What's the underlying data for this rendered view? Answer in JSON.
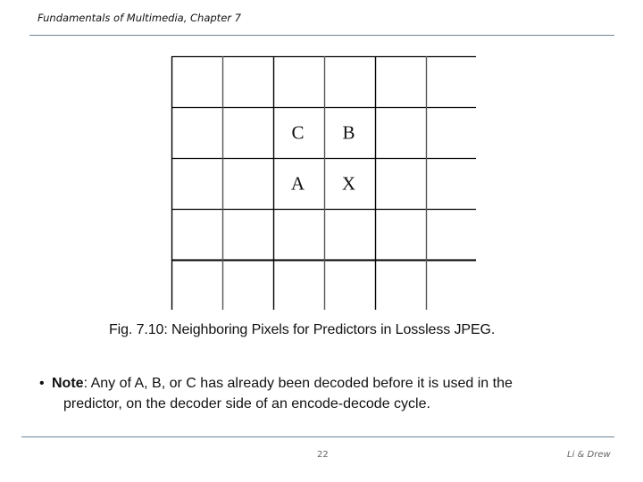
{
  "header": {
    "title": "Fundamentals of Multimedia, Chapter 7"
  },
  "figure": {
    "grid_rows": 5,
    "grid_cols": 6,
    "cells": [
      {
        "label": "C",
        "row": 1,
        "col": 2
      },
      {
        "label": "B",
        "row": 1,
        "col": 3
      },
      {
        "label": "A",
        "row": 2,
        "col": 2
      },
      {
        "label": "X",
        "row": 2,
        "col": 3
      }
    ],
    "caption": "Fig. 7.10: Neighboring Pixels for Predictors in Lossless JPEG."
  },
  "note": {
    "bullet": "•",
    "label": "Note",
    "line1": ": Any of A, B, or C has already been decoded before it is used in the",
    "line2": "predictor, on the decoder side of an encode-decode cycle."
  },
  "footer": {
    "page_number": "22",
    "authors": "Li & Drew"
  }
}
